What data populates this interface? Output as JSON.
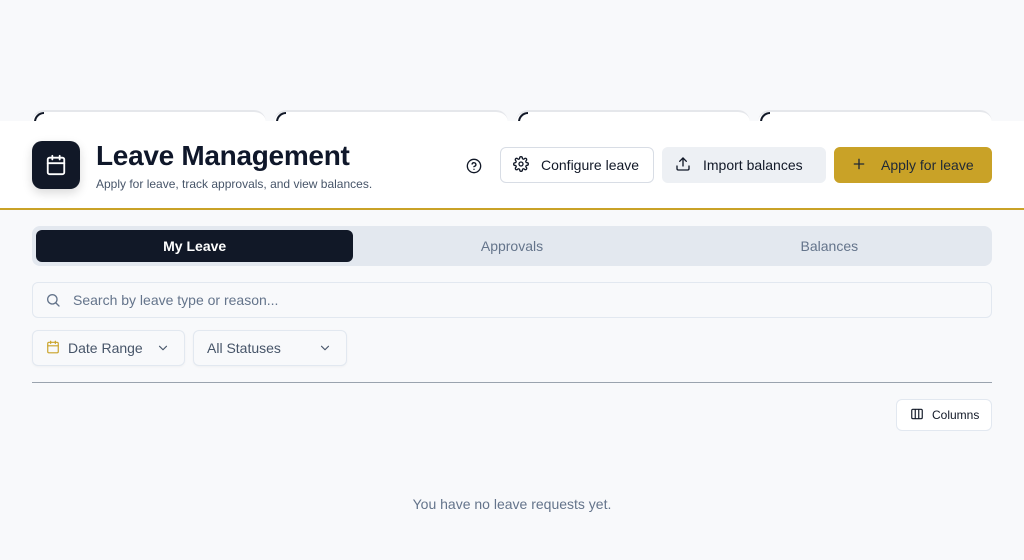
{
  "header": {
    "title": "Leave Management",
    "subtitle": "Apply for leave, track approvals, and view balances.",
    "icons": {
      "app": "calendar-icon",
      "help": "help-circle-icon"
    }
  },
  "toolbar": {
    "configure_label": "Configure leave",
    "import_label": "Import balances",
    "apply_label": "Apply for leave",
    "icons": {
      "configure": "gear-icon",
      "import": "upload-icon",
      "apply": "plus-icon"
    }
  },
  "tabs": [
    {
      "label": "My Leave",
      "active": true
    },
    {
      "label": "Approvals",
      "active": false
    },
    {
      "label": "Balances",
      "active": false
    }
  ],
  "search": {
    "placeholder": "Search by leave type or reason...",
    "value": ""
  },
  "filters": {
    "date_range": "Date Range",
    "status": "All Statuses"
  },
  "table": {
    "columns_label": "Columns",
    "empty_message": "You have no leave requests yet."
  },
  "colors": {
    "accent": "#c9a227",
    "dark": "#111827",
    "muted_text": "#64748b"
  }
}
